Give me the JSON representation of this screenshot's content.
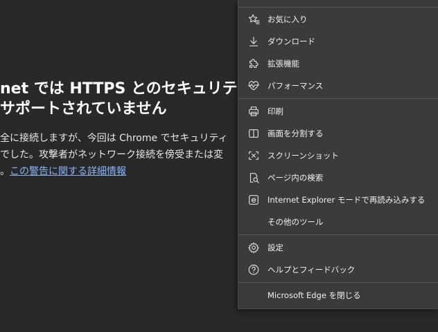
{
  "warning": {
    "title_line1": "net では HTTPS とのセキュリティ",
    "title_line2": "サポートされていません",
    "body_line1": "全に接続しますが、今回は Chrome でセキュリティ",
    "body_line2": "でした。攻撃者がネットワーク接続を傍受または変",
    "body_line3_prefix": "。",
    "link_text": "この警告に関する詳細情報"
  },
  "menu": {
    "items": [
      {
        "label": "お気に入り",
        "icon": "favorites-star-icon"
      },
      {
        "label": "ダウンロード",
        "icon": "download-arrow-icon"
      },
      {
        "label": "拡張機能",
        "icon": "extensions-puzzle-icon"
      },
      {
        "label": "パフォーマンス",
        "icon": "performance-heart-icon"
      },
      {
        "label": "印刷",
        "icon": "printer-icon"
      },
      {
        "label": "画面を分割する",
        "icon": "split-screen-icon"
      },
      {
        "label": "スクリーンショット",
        "icon": "screenshot-icon"
      },
      {
        "label": "ページ内の検索",
        "icon": "find-on-page-icon"
      },
      {
        "label": "Internet Explorer モードで再読み込みする",
        "icon": "internet-explorer-icon"
      },
      {
        "label": "その他のツール",
        "icon": ""
      },
      {
        "label": "設定",
        "icon": "gear-icon"
      },
      {
        "label": "ヘルプとフィードバック",
        "icon": "help-question-icon"
      },
      {
        "label": "Microsoft Edge を閉じる",
        "icon": ""
      }
    ]
  },
  "colors": {
    "page_background": "#292929",
    "menu_background": "#3b3b3b",
    "link": "#8ab4f8"
  }
}
